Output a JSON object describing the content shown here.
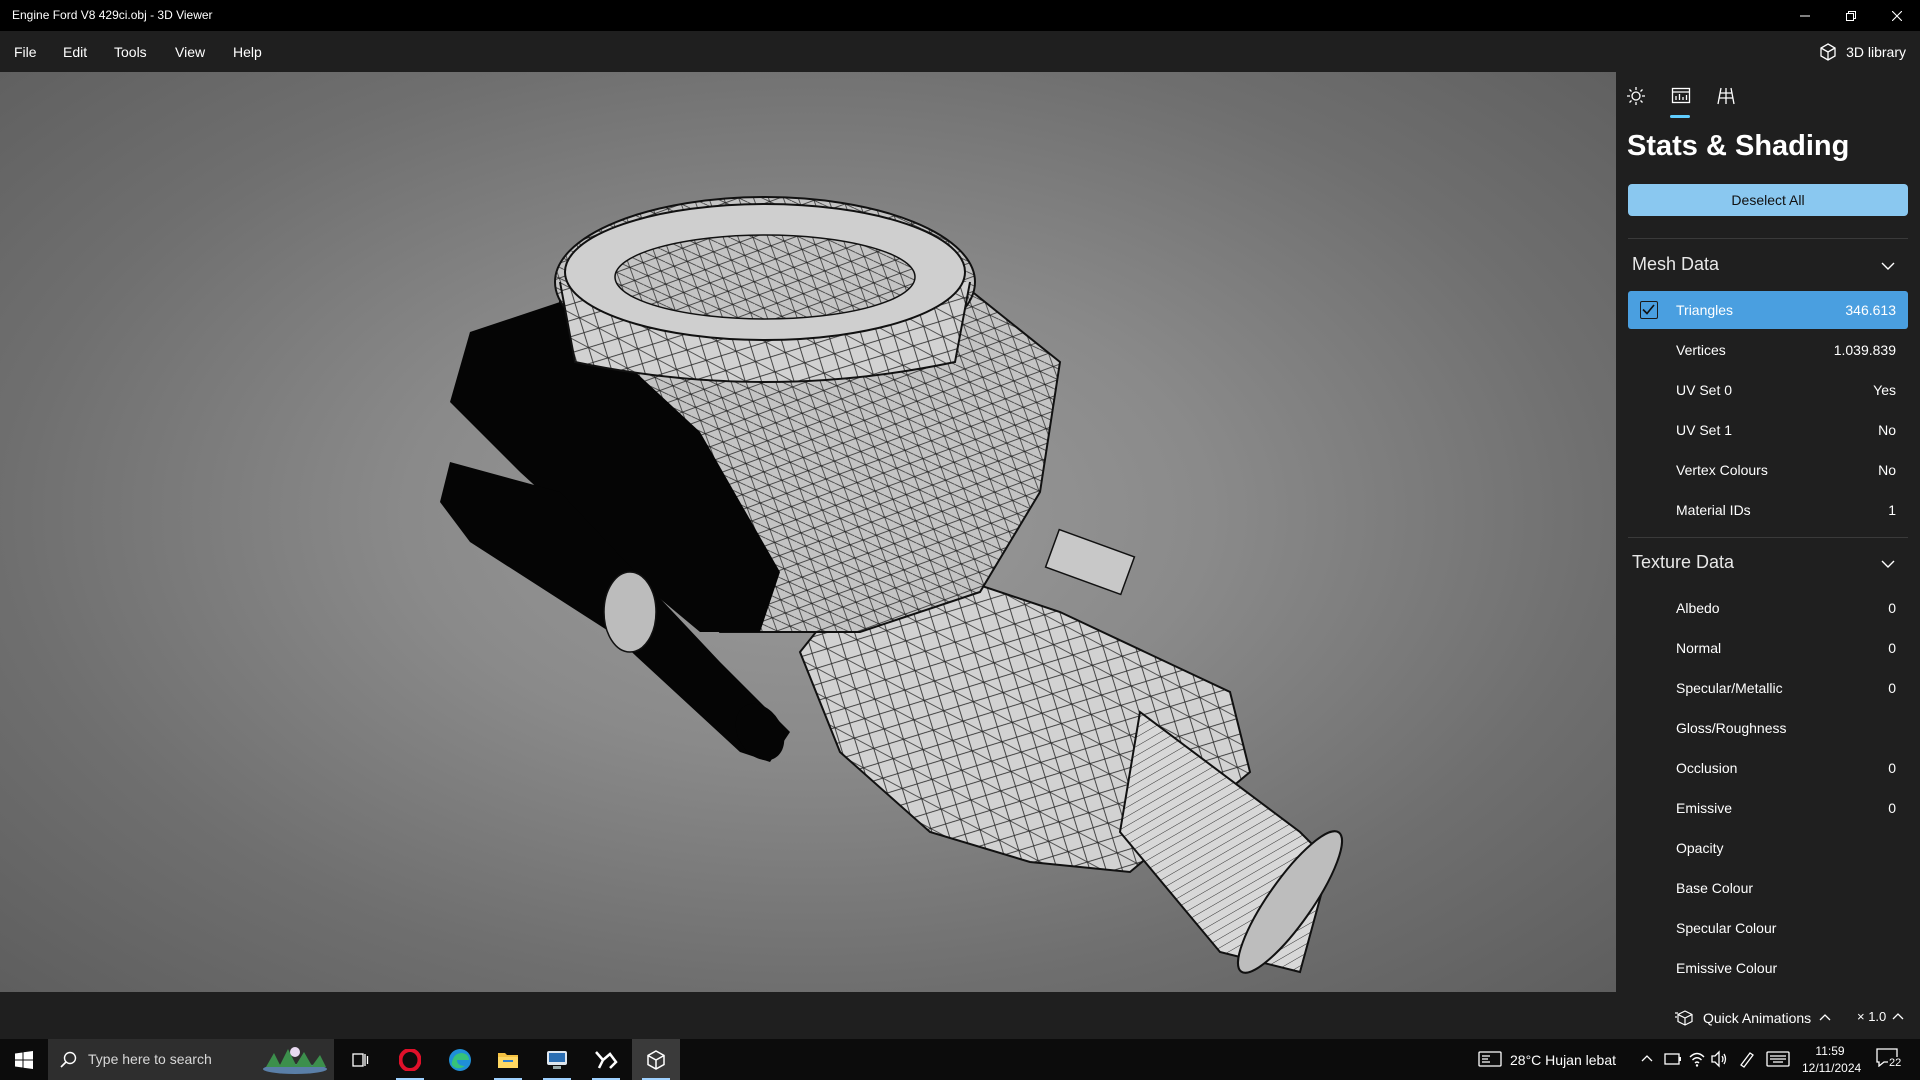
{
  "window": {
    "title": "Engine Ford V8 429ci.obj - 3D Viewer"
  },
  "menu": {
    "items": [
      "File",
      "Edit",
      "Tools",
      "View",
      "Help"
    ],
    "library_label": "3D library"
  },
  "panel": {
    "title": "Stats & Shading",
    "deselect_label": "Deselect All",
    "mesh_section": {
      "title": "Mesh Data",
      "rows": [
        {
          "label": "Triangles",
          "value": "346.613",
          "checked": true
        },
        {
          "label": "Vertices",
          "value": "1.039.839"
        },
        {
          "label": "UV Set 0",
          "value": "Yes"
        },
        {
          "label": "UV Set 1",
          "value": "No"
        },
        {
          "label": "Vertex Colours",
          "value": "No"
        },
        {
          "label": "Material IDs",
          "value": "1"
        }
      ]
    },
    "texture_section": {
      "title": "Texture Data",
      "rows": [
        {
          "label": "Albedo",
          "value": "0"
        },
        {
          "label": "Normal",
          "value": "0"
        },
        {
          "label": "Specular/Metallic",
          "value": "0"
        },
        {
          "label": "Gloss/Roughness",
          "value": ""
        },
        {
          "label": "Occlusion",
          "value": "0"
        },
        {
          "label": "Emissive",
          "value": "0"
        },
        {
          "label": "Opacity",
          "value": ""
        },
        {
          "label": "Base Colour",
          "value": ""
        },
        {
          "label": "Specular Colour",
          "value": ""
        },
        {
          "label": "Emissive Colour",
          "value": ""
        }
      ]
    }
  },
  "statusbar": {
    "quick_animations_label": "Quick Animations",
    "speed": "× 1.0"
  },
  "taskbar": {
    "search_placeholder": "Type here to search",
    "weather": "28°C  Hujan lebat",
    "time": "11:59",
    "date": "12/11/2024",
    "notification_count": "22"
  },
  "colors": {
    "accent": "#60cdff",
    "selected_row": "#4a9fe0",
    "button": "#8ac8f0",
    "viewport_bg": "#8a8a8a"
  },
  "icons": [
    "windows-logo-icon",
    "search-icon",
    "task-view-icon",
    "opera-icon",
    "edge-icon",
    "file-explorer-icon",
    "display-app-icon",
    "tool-app-icon",
    "3d-viewer-icon",
    "lighting-icon",
    "stats-icon",
    "grid-icon",
    "cube-icon",
    "chevron-down-icon"
  ]
}
